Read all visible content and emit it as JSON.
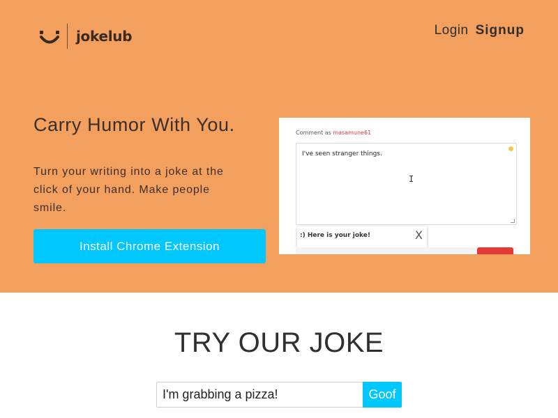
{
  "brand": {
    "name": "jokelub",
    "logo_icon": "smiley-icon"
  },
  "nav": {
    "login_label": "Login",
    "signup_label": "Signup"
  },
  "hero": {
    "headline": "Carry Humor With You.",
    "subtext": "Turn your writing into a joke at the click of your hand. Make people smile.",
    "cta_label": "Install Chrome Extension"
  },
  "preview": {
    "comment_label": "Comment as",
    "username": "masamune61",
    "comment_text": "I've seen stranger things.",
    "popup_text": ":) Here is your joke!",
    "popup_close": "X"
  },
  "try": {
    "title": "TRY OUR JOKE",
    "input_value": "I'm grabbing a pizza!",
    "button_label": "Goof"
  },
  "colors": {
    "hero_bg": "#f3a05e",
    "accent": "#00c8ff",
    "text_dark": "#333333"
  }
}
